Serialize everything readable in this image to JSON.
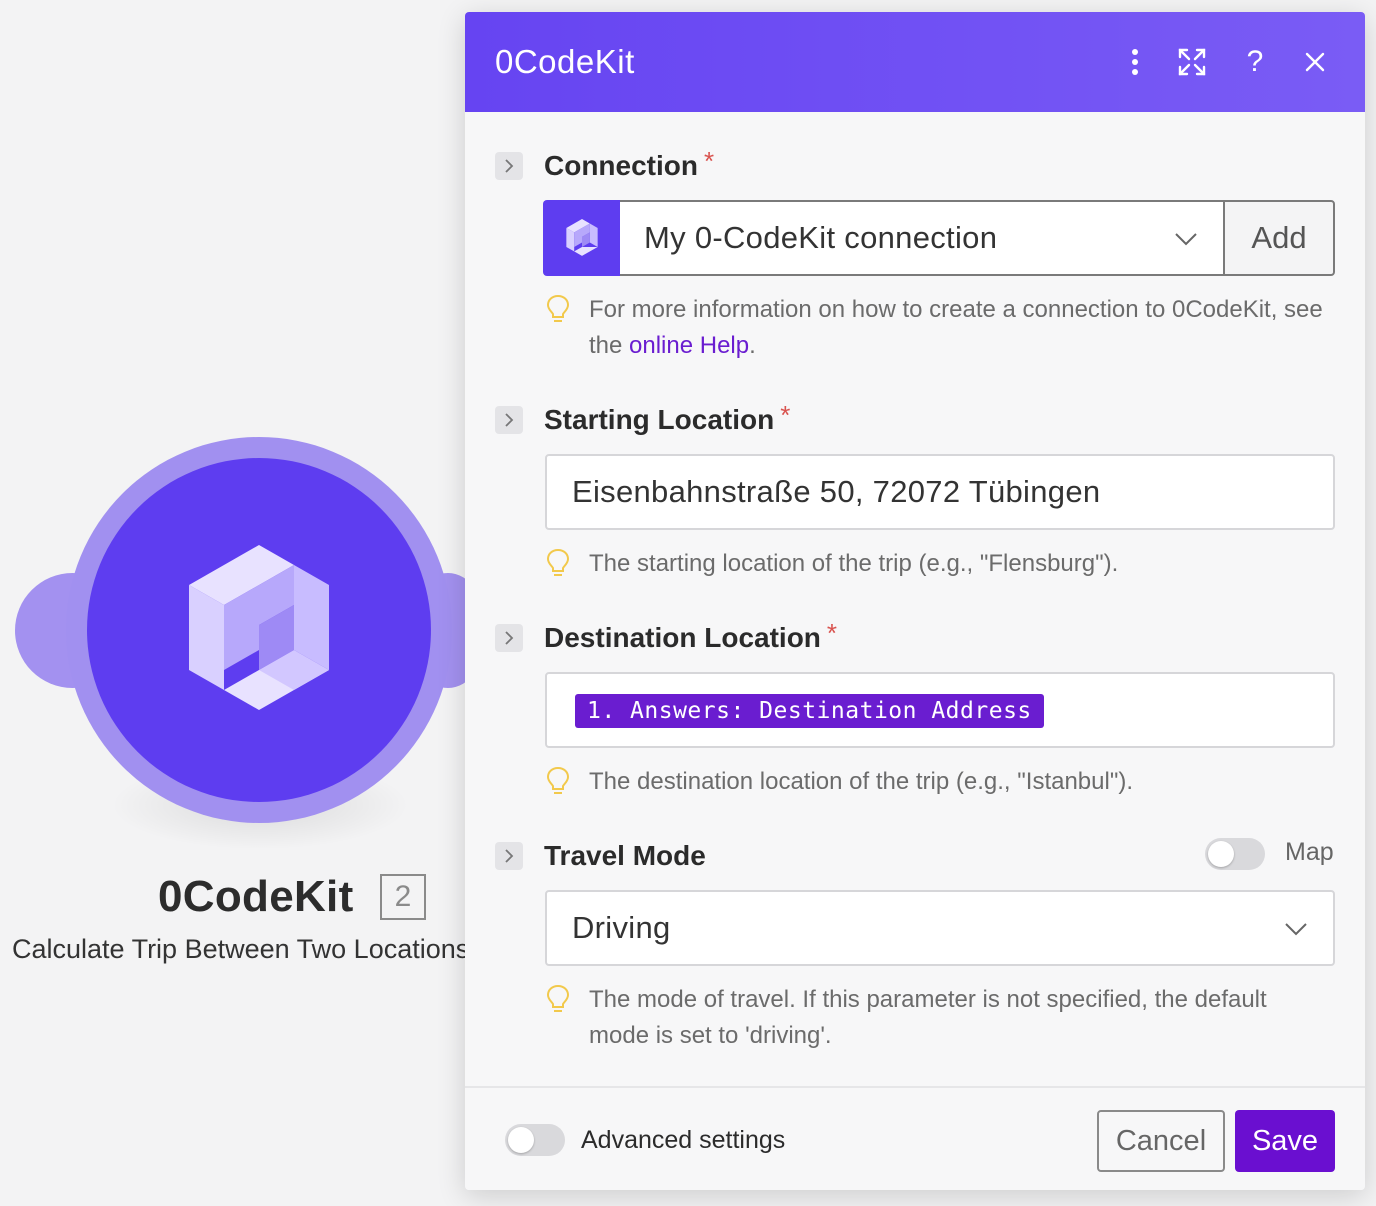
{
  "app": {
    "accent_color": "#6644f2",
    "primary_button_color": "#6a0fd0"
  },
  "module": {
    "title": "0CodeKit",
    "badge": "2",
    "subtitle": "Calculate Trip Between Two Locations",
    "icon": "0codekit-logo-icon"
  },
  "dialog": {
    "title": "0CodeKit",
    "header_icons": [
      "kebab-menu-icon",
      "expand-icon",
      "help-icon",
      "close-icon"
    ],
    "help_glyph": "?"
  },
  "connection": {
    "label": "Connection",
    "required_mark": "*",
    "selected": "My 0-CodeKit connection",
    "add_label": "Add",
    "hint_prefix": "For more information on how to create a connection to 0CodeKit, see the ",
    "hint_link": "online Help",
    "hint_suffix": "."
  },
  "starting_location": {
    "label": "Starting Location",
    "required_mark": "*",
    "value": "Eisenbahnstraße 50, 72072 Tübingen",
    "hint": "The starting location of the trip (e.g., \"Flensburg\")."
  },
  "destination_location": {
    "label": "Destination Location",
    "required_mark": "*",
    "mapped_value": "1. Answers: Destination Address",
    "hint": "The destination location of the trip (e.g., \"Istanbul\")."
  },
  "travel_mode": {
    "label": "Travel Mode",
    "map_toggle_label": "Map",
    "map_toggle_on": false,
    "selected": "Driving",
    "hint": "The mode of travel. If this parameter is not specified, the default mode is set to 'driving'."
  },
  "footer": {
    "advanced_settings_label": "Advanced settings",
    "advanced_settings_on": false,
    "cancel_label": "Cancel",
    "save_label": "Save"
  }
}
